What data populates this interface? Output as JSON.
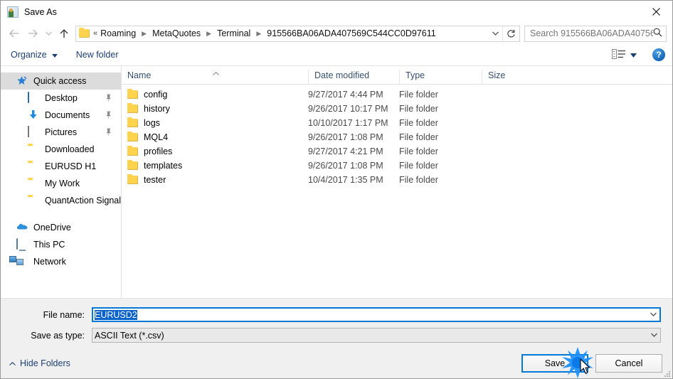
{
  "window": {
    "title": "Save As",
    "icon": "save-as-icon",
    "close_label": "✕"
  },
  "nav": {
    "back_icon": "arrow-left-icon",
    "forward_icon": "arrow-right-icon",
    "recent_icon": "chevron-down-icon",
    "up_icon": "arrow-up-icon",
    "breadcrumb_prefix": "«",
    "breadcrumbs": [
      "Roaming",
      "MetaQuotes",
      "Terminal",
      "915566BA06ADA407569C544CC0D97611"
    ],
    "dropdown_icon": "chevron-down-icon",
    "refresh_icon": "refresh-icon"
  },
  "search": {
    "placeholder": "Search 915566BA06ADA40756...",
    "icon": "search-icon"
  },
  "commandbar": {
    "organize_label": "Organize",
    "organize_caret": "▼",
    "new_folder_label": "New folder",
    "view_icon": "view-list-icon",
    "view_caret": "▼",
    "help_label": "?",
    "help_icon": "help-icon"
  },
  "sidebar": {
    "items": [
      {
        "label": "Quick access",
        "icon": "quick-access-star-icon",
        "level": "root",
        "selected": true,
        "pinned": false
      },
      {
        "label": "Desktop",
        "icon": "desktop-icon",
        "level": "child",
        "selected": false,
        "pinned": true
      },
      {
        "label": "Documents",
        "icon": "documents-download-icon",
        "level": "child",
        "selected": false,
        "pinned": true
      },
      {
        "label": "Pictures",
        "icon": "pictures-icon",
        "level": "child",
        "selected": false,
        "pinned": true
      },
      {
        "label": "Downloaded",
        "icon": "folder-icon",
        "level": "child",
        "selected": false,
        "pinned": false
      },
      {
        "label": "EURUSD H1",
        "icon": "folder-icon",
        "level": "child",
        "selected": false,
        "pinned": false
      },
      {
        "label": "My Work",
        "icon": "folder-icon",
        "level": "child",
        "selected": false,
        "pinned": false
      },
      {
        "label": "QuantAction Signal",
        "icon": "folder-icon",
        "level": "child",
        "selected": false,
        "pinned": false
      },
      {
        "label": "OneDrive",
        "icon": "onedrive-cloud-icon",
        "level": "root",
        "selected": false,
        "pinned": false
      },
      {
        "label": "This PC",
        "icon": "this-pc-icon",
        "level": "root",
        "selected": false,
        "pinned": false
      },
      {
        "label": "Network",
        "icon": "network-icon",
        "level": "root",
        "selected": false,
        "pinned": false
      }
    ],
    "pin_glyph": "📌"
  },
  "filelist": {
    "columns": [
      "Name",
      "Date modified",
      "Type",
      "Size"
    ],
    "sort_caret": "˄",
    "rows": [
      {
        "name": "config",
        "date": "9/27/2017 4:44 PM",
        "type": "File folder",
        "size": ""
      },
      {
        "name": "history",
        "date": "9/26/2017 10:17 PM",
        "type": "File folder",
        "size": ""
      },
      {
        "name": "logs",
        "date": "10/10/2017 1:17 PM",
        "type": "File folder",
        "size": ""
      },
      {
        "name": "MQL4",
        "date": "9/26/2017 1:08 PM",
        "type": "File folder",
        "size": ""
      },
      {
        "name": "profiles",
        "date": "9/27/2017 4:21 PM",
        "type": "File folder",
        "size": ""
      },
      {
        "name": "templates",
        "date": "9/26/2017 1:08 PM",
        "type": "File folder",
        "size": ""
      },
      {
        "name": "tester",
        "date": "10/4/2017 1:35 PM",
        "type": "File folder",
        "size": ""
      }
    ]
  },
  "form": {
    "filename_label": "File name:",
    "filename_value": "EURUSD2",
    "filetype_label": "Save as type:",
    "filetype_value": "ASCII Text (*.csv)",
    "caret_icon": "chevron-down-icon"
  },
  "footer": {
    "hide_folders_label": "Hide Folders",
    "hide_folders_caret": "˄",
    "save_label": "Save",
    "cancel_label": "Cancel"
  },
  "colors": {
    "accent": "#0078d7",
    "selection": "#0a63c9",
    "folder": "#ffd34d",
    "link": "#1c3f72",
    "header_text": "#36506e"
  },
  "pointer": {
    "click_effect": "click-burst",
    "cursor": "arrow-cursor"
  }
}
